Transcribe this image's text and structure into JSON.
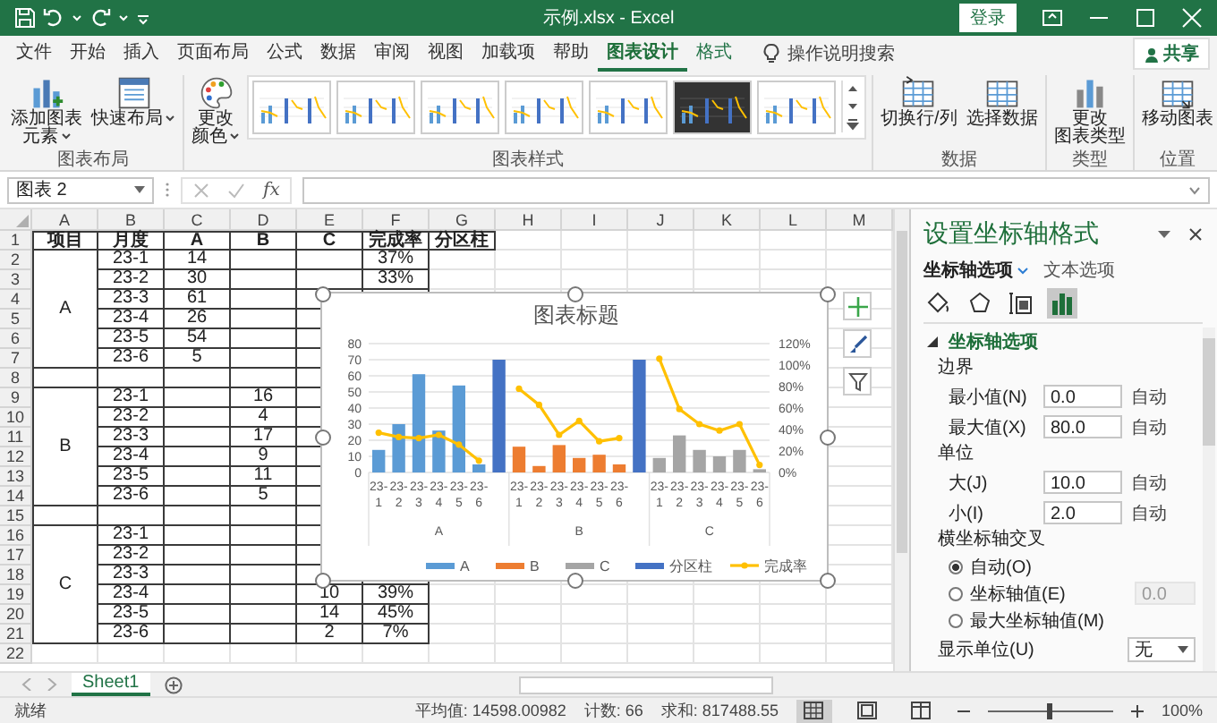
{
  "title_bar": {
    "title": "示例.xlsx  -  Excel",
    "sign_in": "登录"
  },
  "ribbon_tabs": [
    {
      "label": "文件",
      "selected": false,
      "contextual": false
    },
    {
      "label": "开始",
      "selected": false,
      "contextual": false
    },
    {
      "label": "插入",
      "selected": false,
      "contextual": false
    },
    {
      "label": "页面布局",
      "selected": false,
      "contextual": false
    },
    {
      "label": "公式",
      "selected": false,
      "contextual": false
    },
    {
      "label": "数据",
      "selected": false,
      "contextual": false
    },
    {
      "label": "审阅",
      "selected": false,
      "contextual": false
    },
    {
      "label": "视图",
      "selected": false,
      "contextual": false
    },
    {
      "label": "加载项",
      "selected": false,
      "contextual": false
    },
    {
      "label": "帮助",
      "selected": false,
      "contextual": false
    },
    {
      "label": "图表设计",
      "selected": true,
      "contextual": true
    },
    {
      "label": "格式",
      "selected": false,
      "contextual": true
    }
  ],
  "tell_me": "操作说明搜索",
  "share": "共享",
  "ribbon_groups": [
    {
      "label": "图表布局",
      "commands": [
        {
          "kind": "add_element",
          "lines": [
            "添加图表",
            "元素"
          ],
          "menu": true
        },
        {
          "kind": "quick_layout",
          "lines": [
            "快速布局"
          ],
          "menu": true
        }
      ]
    },
    {
      "label": "图表样式",
      "commands": [
        {
          "kind": "colors",
          "lines": [
            "更改",
            "颜色"
          ],
          "menu": true
        }
      ],
      "gallery": [
        {
          "dark": false
        },
        {
          "dark": false
        },
        {
          "dark": false
        },
        {
          "dark": false
        },
        {
          "dark": false
        },
        {
          "dark": true
        },
        {
          "dark": false
        }
      ]
    },
    {
      "label": "数据",
      "commands": [
        {
          "kind": "switch",
          "lines": [
            "切换行/列"
          ],
          "menu": false
        },
        {
          "kind": "select_data",
          "lines": [
            "选择数据"
          ],
          "menu": false
        }
      ]
    },
    {
      "label": "类型",
      "commands": [
        {
          "kind": "chart_type",
          "lines": [
            "更改",
            "图表类型"
          ],
          "menu": false
        }
      ]
    },
    {
      "label": "位置",
      "commands": [
        {
          "kind": "move",
          "lines": [
            "移动图表"
          ],
          "menu": false
        }
      ]
    }
  ],
  "formula_bar": {
    "name_box": "图表 2",
    "function": "fx"
  },
  "sheet": {
    "columns": [
      "A",
      "B",
      "C",
      "D",
      "E",
      "F",
      "G",
      "H",
      "I",
      "J",
      "K",
      "L",
      "M"
    ],
    "row_numbers": [
      "1",
      "2",
      "3",
      "4",
      "5",
      "6",
      "7",
      "8",
      "9",
      "10",
      "11",
      "12",
      "13",
      "14",
      "15",
      "16",
      "17",
      "18",
      "19",
      "20",
      "21",
      "22"
    ],
    "header": [
      "项目",
      "月度",
      "A",
      "B",
      "C",
      "完成率",
      "分区柱"
    ],
    "groups": [
      {
        "item": "A",
        "rows": [
          {
            "month": "23-1",
            "a": "14",
            "rate": "37%"
          },
          {
            "month": "23-2",
            "a": "30",
            "rate": "33%"
          },
          {
            "month": "23-3",
            "a": "61"
          },
          {
            "month": "23-4",
            "a": "26"
          },
          {
            "month": "23-5",
            "a": "54"
          },
          {
            "month": "23-6",
            "a": "5"
          }
        ]
      },
      {
        "item": "B",
        "rows": [
          {
            "month": "23-1",
            "b": "16"
          },
          {
            "month": "23-2",
            "b": "4"
          },
          {
            "month": "23-3",
            "b": "17"
          },
          {
            "month": "23-4",
            "b": "9"
          },
          {
            "month": "23-5",
            "b": "11"
          },
          {
            "month": "23-6",
            "b": "5"
          }
        ]
      },
      {
        "item": "C",
        "rows": [
          {
            "month": "23-1"
          },
          {
            "month": "23-2"
          },
          {
            "month": "23-3"
          },
          {
            "month": "23-4",
            "c": "10",
            "rate": "39%"
          },
          {
            "month": "23-5",
            "c": "14",
            "rate": "45%"
          },
          {
            "month": "23-6",
            "c": "2",
            "rate": "7%"
          }
        ]
      }
    ]
  },
  "chart": {
    "category_groups": [
      "A",
      "B",
      "C"
    ],
    "chart_data": {
      "type": "bar",
      "title": "图表标题",
      "grid": true,
      "legend": "bottom",
      "categories": [
        "23-1",
        "23-2",
        "23-3",
        "23-4",
        "23-5",
        "23-6",
        null,
        "23-1",
        "23-2",
        "23-3",
        "23-4",
        "23-5",
        "23-6",
        null,
        "23-1",
        "23-2",
        "23-3",
        "23-4",
        "23-5",
        "23-6"
      ],
      "ylim": [
        0,
        80
      ],
      "yticks": [
        0,
        10,
        20,
        30,
        40,
        50,
        60,
        70,
        80
      ],
      "y2lim": [
        0,
        120
      ],
      "y2ticks": [
        {
          "value": 0,
          "label": "0%"
        },
        {
          "value": 20,
          "label": "20%"
        },
        {
          "value": 40,
          "label": "40%"
        },
        {
          "value": 60,
          "label": "60%"
        },
        {
          "value": 80,
          "label": "80%"
        },
        {
          "value": 100,
          "label": "100%"
        },
        {
          "value": 120,
          "label": "120%"
        }
      ],
      "series": [
        {
          "name": "A",
          "color": "#5b9bd5",
          "values": [
            14,
            30,
            61,
            26,
            54,
            5,
            null,
            null,
            null,
            null,
            null,
            null,
            null,
            null,
            null,
            null,
            null,
            null,
            null,
            null
          ]
        },
        {
          "name": "B",
          "color": "#ed7d31",
          "values": [
            null,
            null,
            null,
            null,
            null,
            null,
            null,
            16,
            4,
            17,
            9,
            11,
            5,
            null,
            null,
            null,
            null,
            null,
            null,
            null
          ]
        },
        {
          "name": "C",
          "color": "#a5a5a5",
          "values": [
            null,
            null,
            null,
            null,
            null,
            null,
            null,
            null,
            null,
            null,
            null,
            null,
            null,
            null,
            9,
            23,
            14,
            10,
            14,
            2
          ]
        },
        {
          "name": "分区柱",
          "color": "#4472c4",
          "values": [
            null,
            null,
            null,
            null,
            null,
            null,
            70,
            null,
            null,
            null,
            null,
            null,
            null,
            70,
            null,
            null,
            null,
            null,
            null,
            null
          ]
        },
        {
          "name": "完成率",
          "color": "#ffc000",
          "type": "line",
          "axis": "y2",
          "marker": "circle",
          "values": [
            37,
            33,
            32,
            35,
            26,
            11,
            null,
            78,
            63,
            35,
            48,
            29,
            32,
            null,
            106,
            59,
            45,
            39,
            45,
            7
          ]
        }
      ]
    }
  },
  "format_pane": {
    "title": "设置坐标轴格式",
    "tabs": [
      {
        "label": "坐标轴选项",
        "selected": true
      },
      {
        "label": "文本选项",
        "selected": false
      }
    ],
    "icon_tabs": [
      {
        "kind": "fill",
        "selected": false
      },
      {
        "kind": "effects",
        "selected": false
      },
      {
        "kind": "size",
        "selected": false
      },
      {
        "kind": "axis",
        "selected": true
      }
    ],
    "section": {
      "title": "坐标轴选项",
      "expanded": true
    },
    "groups": [
      {
        "heading": "边界",
        "fields": [
          {
            "label": "最小值(N)",
            "value": "0.0",
            "reset": "自动"
          },
          {
            "label": "最大值(X)",
            "value": "80.0",
            "reset": "自动"
          }
        ]
      },
      {
        "heading": "单位",
        "fields": [
          {
            "label": "大(J)",
            "value": "10.0",
            "reset": "自动"
          },
          {
            "label": "小(I)",
            "value": "2.0",
            "reset": "自动"
          }
        ]
      }
    ],
    "crosses": {
      "heading": "横坐标轴交叉",
      "options": [
        {
          "label": "自动(O)",
          "selected": true
        },
        {
          "label": "坐标轴值(E)",
          "selected": false,
          "value": "0.0",
          "disabled": true
        },
        {
          "label": "最大坐标轴值(M)",
          "selected": false
        }
      ]
    },
    "display_units": {
      "label": "显示单位(U)",
      "value": "无"
    }
  },
  "sheets": [
    {
      "name": "Sheet1",
      "selected": true
    }
  ],
  "status_bar": {
    "ready": "就绪",
    "average": "平均值: 14598.00982",
    "count": "计数: 66",
    "sum": "求和: 817488.55",
    "views": [
      {
        "kind": "normal",
        "selected": true
      },
      {
        "kind": "page_layout",
        "selected": false
      },
      {
        "kind": "page_break",
        "selected": false
      }
    ],
    "zoom": {
      "level": 0.5,
      "value": "100%"
    }
  }
}
